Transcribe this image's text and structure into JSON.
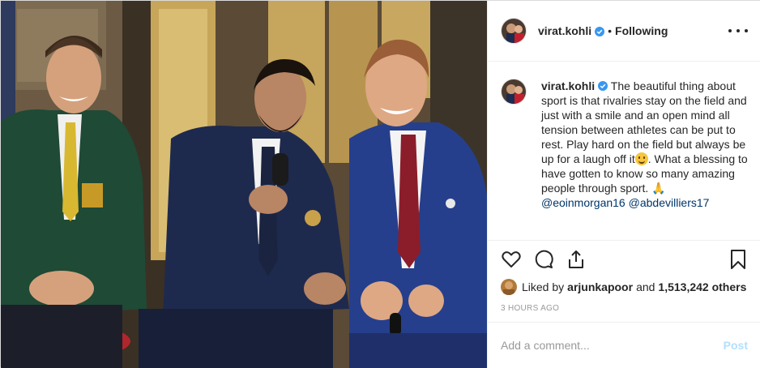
{
  "colors": {
    "text": "#262626",
    "muted": "#999999",
    "mention": "#003569",
    "post_button_disabled": "#b2dffc",
    "border": "#efefef",
    "verified_badge": "#3897f0"
  },
  "photo": {
    "icon": "photo-three-men-in-blazers-laughing"
  },
  "header": {
    "username": "virat.kohli",
    "separator": "•",
    "follow_state": "Following",
    "more_icon": "more-horizontal-icon"
  },
  "caption": {
    "username": "virat.kohli",
    "text_part1": "The beautiful thing about sport is that rivalries stay on the field and just with a smile and an open mind all tension between athletes can be put to rest. Play hard on the field but always be up for a laugh off it",
    "text_part2": ". What a blessing to have gotten to know so many amazing people through sport. 🙏 ",
    "mention1": "@eoinmorgan16",
    "mention2": "@abdevilliers17",
    "emoji_icon": "grinning-face-emoji-icon"
  },
  "actions": {
    "like_icon": "heart-icon",
    "comment_icon": "comment-icon",
    "share_icon": "share-icon",
    "save_icon": "bookmark-icon"
  },
  "likes": {
    "prefix": "Liked by",
    "user": "arjunkapoor",
    "conjunction": "and",
    "count": "1,513,242 others"
  },
  "timestamp": "3 HOURS AGO",
  "comment": {
    "placeholder": "Add a comment...",
    "post_label": "Post"
  }
}
